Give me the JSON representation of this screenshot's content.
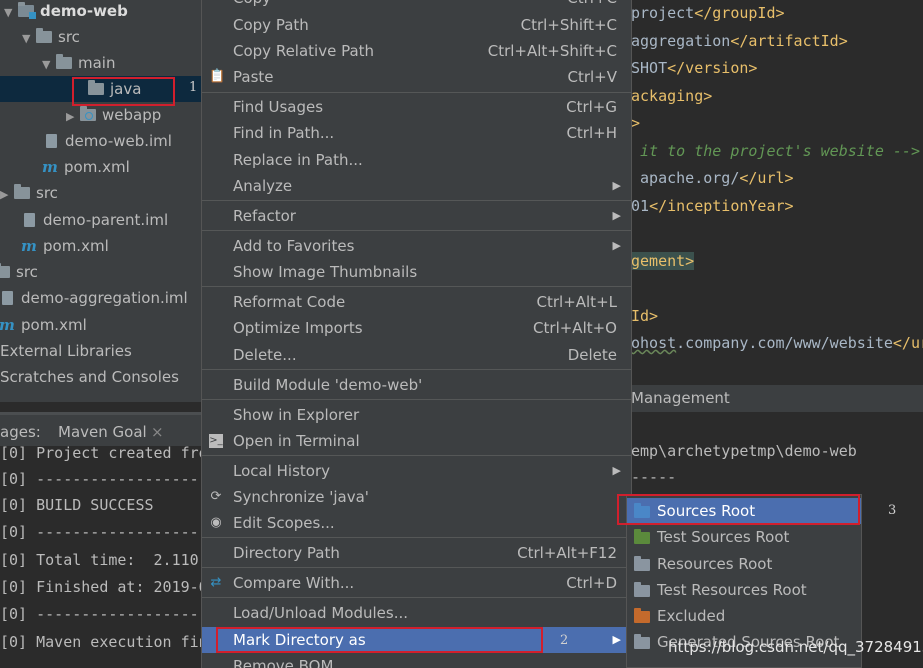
{
  "project_tree": {
    "items": [
      {
        "label": "demo-web"
      },
      {
        "label": "src"
      },
      {
        "label": "main"
      },
      {
        "label": "java"
      },
      {
        "label": "webapp"
      },
      {
        "label": "demo-web.iml"
      },
      {
        "label": "pom.xml"
      },
      {
        "label": "src"
      },
      {
        "label": "demo-parent.iml"
      },
      {
        "label": "pom.xml"
      },
      {
        "label": "src"
      },
      {
        "label": "demo-aggregation.iml"
      },
      {
        "label": "pom.xml"
      },
      {
        "label": "External Libraries"
      },
      {
        "label": "Scratches and Consoles"
      }
    ],
    "annotation_1": "1"
  },
  "editor": {
    "lines": [
      {
        "a": "project",
        "b": "</groupId>"
      },
      {
        "a": "aggregation",
        "b": "</artifactId>"
      },
      {
        "a": "SHOT",
        "b": "</version>"
      },
      {
        "a": "ackaging>"
      },
      {
        "a": ">"
      },
      {
        "a": " it to the project's website -->"
      },
      {
        "a": " apache.org/",
        "b": "</url>"
      },
      {
        "a": "01",
        "b": "</inceptionYear>"
      },
      {
        "a": "gement>"
      },
      {
        "a": "Id>"
      },
      {
        "a": "ohost",
        "b": ".company.com/www/website",
        "c": "</ur"
      }
    ]
  },
  "maven": {
    "panel_title": "Management",
    "tab_messages": "ages:",
    "tab_goal": "Maven Goal",
    "tab_close": "×",
    "console_left": [
      "[0] Project created fro",
      "[0] -------------------",
      "[0] BUILD SUCCESS",
      "[0] -------------------",
      "[0] Total time:  2.110",
      "[0] Finished at: 2019-0",
      "[0] -------------------",
      "[0] Maven execution fin"
    ],
    "console_right": [
      "emp\\archetypetmp\\demo-web",
      "-----"
    ]
  },
  "context_menu": {
    "items": [
      {
        "label": "Copy",
        "shortcut": "Ctrl+C"
      },
      {
        "label": "Copy Path",
        "shortcut": "Ctrl+Shift+C"
      },
      {
        "label": "Copy Relative Path",
        "shortcut": "Ctrl+Alt+Shift+C"
      },
      {
        "label": "Paste",
        "shortcut": "Ctrl+V"
      },
      {
        "label": "Find Usages",
        "shortcut": "Ctrl+G"
      },
      {
        "label": "Find in Path...",
        "shortcut": "Ctrl+H"
      },
      {
        "label": "Replace in Path..."
      },
      {
        "label": "Analyze"
      },
      {
        "label": "Refactor"
      },
      {
        "label": "Add to Favorites"
      },
      {
        "label": "Show Image Thumbnails"
      },
      {
        "label": "Reformat Code",
        "shortcut": "Ctrl+Alt+L"
      },
      {
        "label": "Optimize Imports",
        "shortcut": "Ctrl+Alt+O"
      },
      {
        "label": "Delete...",
        "shortcut": "Delete"
      },
      {
        "label": "Build Module 'demo-web'"
      },
      {
        "label": "Show in Explorer"
      },
      {
        "label": "Open in Terminal"
      },
      {
        "label": "Local History"
      },
      {
        "label": "Synchronize 'java'"
      },
      {
        "label": "Edit Scopes..."
      },
      {
        "label": "Directory Path",
        "shortcut": "Ctrl+Alt+F12"
      },
      {
        "label": "Compare With...",
        "shortcut": "Ctrl+D"
      },
      {
        "label": "Load/Unload Modules..."
      },
      {
        "label": "Mark Directory as"
      },
      {
        "label": "Remove BOM"
      }
    ],
    "annotation_2": "2"
  },
  "submenu": {
    "items": [
      {
        "label": "Sources Root",
        "color": "#4a87c7"
      },
      {
        "label": "Test Sources Root",
        "color": "#5b8a3c"
      },
      {
        "label": "Resources Root",
        "color": "#8a95a0"
      },
      {
        "label": "Test Resources Root",
        "color": "#8a95a0"
      },
      {
        "label": "Excluded",
        "color": "#c46a2c"
      },
      {
        "label": "Generated Sources Root",
        "color": "#8a95a0"
      }
    ],
    "annotation_3": "3"
  },
  "watermark": "https://blog.csdn.net/qq_37284915",
  "colors": {
    "menu_bg": "#3c3f41",
    "selection": "#4b6eaf",
    "highlight_box": "#d11f2d"
  }
}
